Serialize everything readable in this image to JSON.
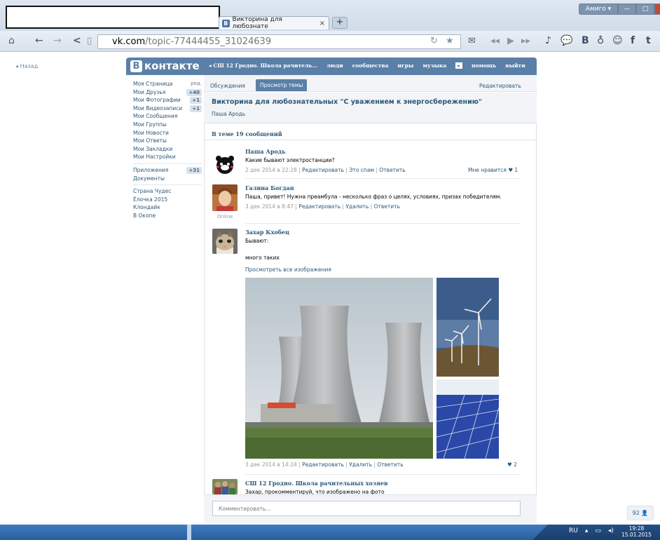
{
  "browser": {
    "tab_title": "Викторина для любознате",
    "tab_close": "×",
    "new_tab": "+",
    "url_host": "vk.com",
    "url_path": "/topic-77444455_31024639",
    "user_button": "Амиго ▾",
    "win_min": "—",
    "win_max": "□",
    "win_close": "✕"
  },
  "vk": {
    "back": "Назад",
    "logo_b": "В",
    "logo_text": "контакте",
    "nav": [
      "◂ СШ 12 Гродно. Школа рачитель...",
      "люди",
      "сообщества",
      "игры",
      "музыка",
      "▸",
      "помощь",
      "выйти"
    ]
  },
  "left_menu": {
    "edit": "ред.",
    "items": [
      {
        "label": "Моя Страница",
        "badge": ""
      },
      {
        "label": "Мои Друзья",
        "badge": "+40"
      },
      {
        "label": "Мои Фотографии",
        "badge": "+1"
      },
      {
        "label": "Мои Видеозаписи",
        "badge": "+1"
      },
      {
        "label": "Мои Сообщения",
        "badge": ""
      },
      {
        "label": "Мои Группы",
        "badge": ""
      },
      {
        "label": "Мои Новости",
        "badge": ""
      },
      {
        "label": "Мои Ответы",
        "badge": ""
      },
      {
        "label": "Мои Закладки",
        "badge": ""
      },
      {
        "label": "Мои Настройки",
        "badge": ""
      }
    ],
    "apps": [
      {
        "label": "Приложения",
        "badge": "+31"
      },
      {
        "label": "Документы",
        "badge": ""
      }
    ],
    "games": [
      "Страна Чудес",
      "Ёлочка 2015",
      "Клондайк",
      "В Окопе"
    ]
  },
  "topic": {
    "tab_discussions": "Обсуждения",
    "tab_view": "Просмотр темы",
    "tab_edit": "Редактировать",
    "title": "Викторина для любознательных \"С уважением к энергосбережению\"",
    "author": "Паша Ародь",
    "message_count": "В теме 19 сообщений"
  },
  "posts": [
    {
      "author": "Паша Ародь",
      "text": "Какие бывают электростанции?",
      "date": "2 дек 2014 в 22:28",
      "actions": [
        "Редактировать",
        "Это спам",
        "Ответить"
      ],
      "like": "Мне нравится ♥ 1"
    },
    {
      "author": "Галина Богдан",
      "text": "Паша, привет! Нужна преамбула - несколько фраз о целях, условиях, призах победителям.",
      "date": "3 дек 2014 в 8:47",
      "actions": [
        "Редактировать",
        "Удалить",
        "Ответить"
      ],
      "online": "Online"
    },
    {
      "author": "Захар Кхобец",
      "text1": "Бывают:",
      "text2": "много таких",
      "view_all": "Просмотреть все изображения",
      "date": "3 дек 2014 в 14:24",
      "actions": [
        "Редактировать",
        "Удалить",
        "Ответить"
      ],
      "like": "♥ 2"
    },
    {
      "author": "СШ 12 Гродно. Школа рачительных хозяев",
      "text": "Захар, прокомментируй, что изображено на фото"
    }
  ],
  "comment": {
    "placeholder": "Комментировать..."
  },
  "counter": "92 👤",
  "taskbar": {
    "lang": "RU",
    "time": "19:28",
    "date": "15.01.2015"
  },
  "colors": {
    "vk_blue": "#5b80a8",
    "link": "#2b587a",
    "taskbar": "#2a5f9e"
  }
}
